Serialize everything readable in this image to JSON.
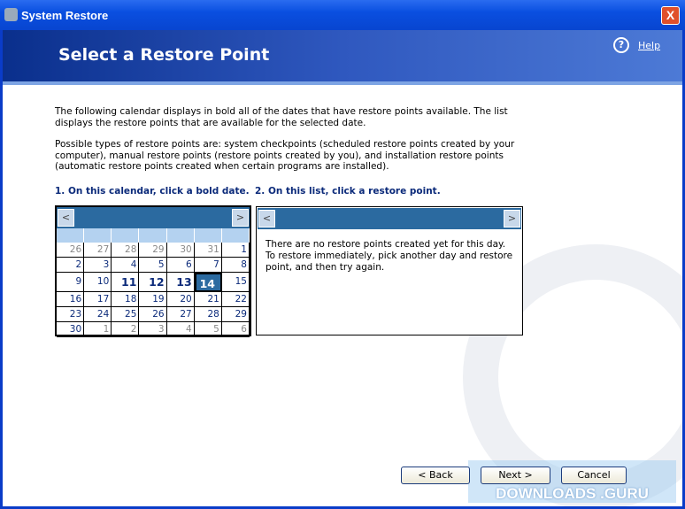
{
  "window": {
    "title": "System Restore",
    "close": "X"
  },
  "header": {
    "title": "Select a Restore Point",
    "help": "Help"
  },
  "intro": {
    "p1": "The following calendar displays in bold all of the dates that have restore points available. The list displays the restore points that are available for the selected date.",
    "p2": "Possible types of restore points are: system checkpoints (scheduled restore points created by your computer), manual restore points (restore points created by you), and installation restore points (automatic restore points created when certain programs are installed)."
  },
  "step1": "1. On this calendar, click a bold date.",
  "step2": "2. On this list, click a restore point.",
  "calendar": {
    "prev": "<",
    "next": ">",
    "selected": "14",
    "days": [
      [
        "26",
        "27",
        "28",
        "29",
        "30",
        "31",
        "1"
      ],
      [
        "2",
        "3",
        "4",
        "5",
        "6",
        "7",
        "8"
      ],
      [
        "9",
        "10",
        "11",
        "12",
        "13",
        "14",
        "15"
      ],
      [
        "16",
        "17",
        "18",
        "19",
        "20",
        "21",
        "22"
      ],
      [
        "23",
        "24",
        "25",
        "26",
        "27",
        "28",
        "29"
      ],
      [
        "30",
        "1",
        "2",
        "3",
        "4",
        "5",
        "6"
      ]
    ]
  },
  "list": {
    "prev": "<",
    "next": ">",
    "message": "There are no restore points created yet for this day. To restore immediately, pick another day and restore point, and then try again."
  },
  "buttons": {
    "back": "< Back",
    "next": "Next >",
    "cancel": "Cancel"
  },
  "watermark": "DOWNLOADS .GURU"
}
